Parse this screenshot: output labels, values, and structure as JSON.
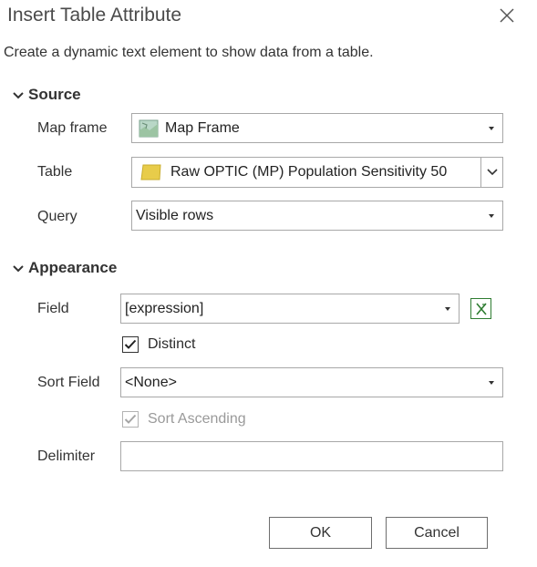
{
  "dialog": {
    "title": "Insert Table Attribute",
    "description": "Create a dynamic text element to show data from a table."
  },
  "source": {
    "heading": "Source",
    "map_frame": {
      "label": "Map frame",
      "value": "Map Frame",
      "icon": "map-frame-icon"
    },
    "table": {
      "label": "Table",
      "value": "Raw OPTIC (MP) Population Sensitivity 50",
      "icon": "polygon-layer-icon",
      "icon_color": "#e8cc4a"
    },
    "query": {
      "label": "Query",
      "value": "Visible rows"
    }
  },
  "appearance": {
    "heading": "Appearance",
    "field": {
      "label": "Field",
      "value": "[expression]",
      "expression_icon": "expression-icon"
    },
    "distinct": {
      "label": "Distinct",
      "checked": true
    },
    "sort_field": {
      "label": "Sort Field",
      "value": "<None>"
    },
    "sort_ascending": {
      "label": "Sort Ascending",
      "checked": true,
      "disabled": true
    },
    "delimiter": {
      "label": "Delimiter",
      "value": ""
    }
  },
  "buttons": {
    "ok": "OK",
    "cancel": "Cancel"
  },
  "colors": {
    "expression_green": "#2f7d32",
    "layer_yellow": "#e8cc4a",
    "border": "#a8a8a8"
  }
}
